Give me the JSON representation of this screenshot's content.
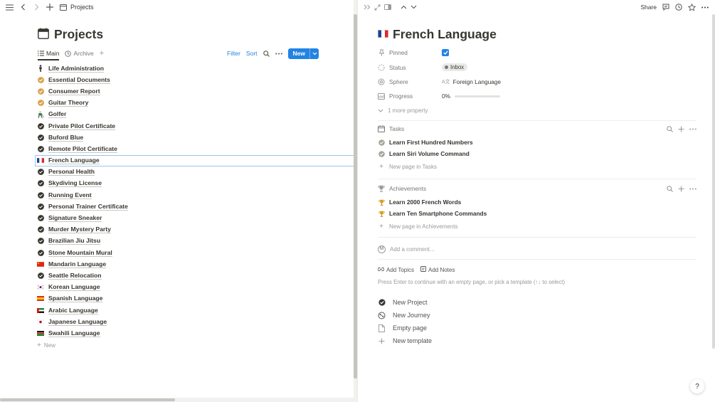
{
  "topbar": {
    "breadcrumb": "Projects",
    "icons": [
      "menu-icon",
      "back-icon",
      "forward-icon",
      "add-icon",
      "calendar-icon"
    ]
  },
  "left": {
    "page_title": "Projects",
    "views": [
      {
        "label": "Main",
        "icon": "list-icon",
        "active": true
      },
      {
        "label": "Archive",
        "icon": "clock-icon",
        "active": false
      }
    ],
    "actions": {
      "filter": "Filter",
      "sort": "Sort",
      "new": "New"
    },
    "projects": [
      {
        "label": "Life Administration",
        "icon": "person",
        "selected": false
      },
      {
        "label": "Essential Documents",
        "icon": "check-gold",
        "selected": false
      },
      {
        "label": "Consumer Report",
        "icon": "check-gold",
        "selected": false
      },
      {
        "label": "Guitar Theory",
        "icon": "check-gold",
        "selected": false
      },
      {
        "label": "Golfer",
        "icon": "golfer",
        "selected": false
      },
      {
        "label": "Private Pilot Certificate",
        "icon": "check-dark",
        "selected": false
      },
      {
        "label": "Buford Blue",
        "icon": "check-dark",
        "selected": false
      },
      {
        "label": "Remote Pilot Certificate",
        "icon": "check-dark",
        "selected": false
      },
      {
        "label": "French Language",
        "icon": "flag-fr",
        "selected": true
      },
      {
        "label": "Personal Health",
        "icon": "check-dark",
        "selected": false
      },
      {
        "label": "Skydiving License",
        "icon": "check-dark",
        "selected": false
      },
      {
        "label": "Running Event",
        "icon": "check-dark",
        "selected": false
      },
      {
        "label": "Personal Trainer Certificate",
        "icon": "check-dark",
        "selected": false
      },
      {
        "label": "Signature Sneaker",
        "icon": "check-dark",
        "selected": false
      },
      {
        "label": "Murder Mystery Party",
        "icon": "check-dark",
        "selected": false
      },
      {
        "label": "Brazilian Jiu Jitsu",
        "icon": "check-dark",
        "selected": false
      },
      {
        "label": "Stone Mountain Mural",
        "icon": "check-dark",
        "selected": false
      },
      {
        "label": "Mandarin Language",
        "icon": "flag-cn",
        "selected": false
      },
      {
        "label": "Seattle Relocation",
        "icon": "check-dark",
        "selected": false
      },
      {
        "label": "Korean Language",
        "icon": "flag-kr",
        "selected": false
      },
      {
        "label": "Spanish Language",
        "icon": "flag-es",
        "selected": false
      },
      {
        "label": "Arabic Language",
        "icon": "flag-ae",
        "selected": false
      },
      {
        "label": "Japanese Language",
        "icon": "flag-jp",
        "selected": false
      },
      {
        "label": "Swahili Language",
        "icon": "flag-ke",
        "selected": false
      }
    ],
    "new_row": "New"
  },
  "right": {
    "share": "Share",
    "title": "French Language",
    "properties": {
      "pinned": {
        "label": "Pinned",
        "checked": true
      },
      "status": {
        "label": "Status",
        "value": "Inbox"
      },
      "sphere": {
        "label": "Sphere",
        "value": "Foreign Language",
        "icon_text": "A文"
      },
      "progress": {
        "label": "Progress",
        "value": "0%",
        "fraction": 0
      }
    },
    "more_property": "1 more property",
    "tasks": {
      "heading": "Tasks",
      "items": [
        "Learn First Hundred Numbers",
        "Learn Siri Volume Command"
      ],
      "add": "New page in Tasks"
    },
    "achievements": {
      "heading": "Achievements",
      "items": [
        "Learn 2000 French Words",
        "Learn Ten Smartphone Commands"
      ],
      "add": "New page in Achievements"
    },
    "comment": {
      "avatar": "M",
      "placeholder": "Add a comment..."
    },
    "links": {
      "topics": "Add Topics",
      "notes": "Add Notes"
    },
    "hint": "Press Enter to continue with an empty page, or pick a template (↑↓ to select)",
    "templates": [
      {
        "label": "New Project",
        "icon": "check-circle-icon"
      },
      {
        "label": "New Journey",
        "icon": "journey-icon"
      },
      {
        "label": "Empty page",
        "icon": "page-icon"
      },
      {
        "label": "New template",
        "icon": "plus-icon"
      }
    ],
    "help": "?"
  },
  "colors": {
    "accent": "#2383e2",
    "check_dark": "#37352f",
    "check_gold": "#d9a14a",
    "selection_border": "#9ec3eb"
  }
}
